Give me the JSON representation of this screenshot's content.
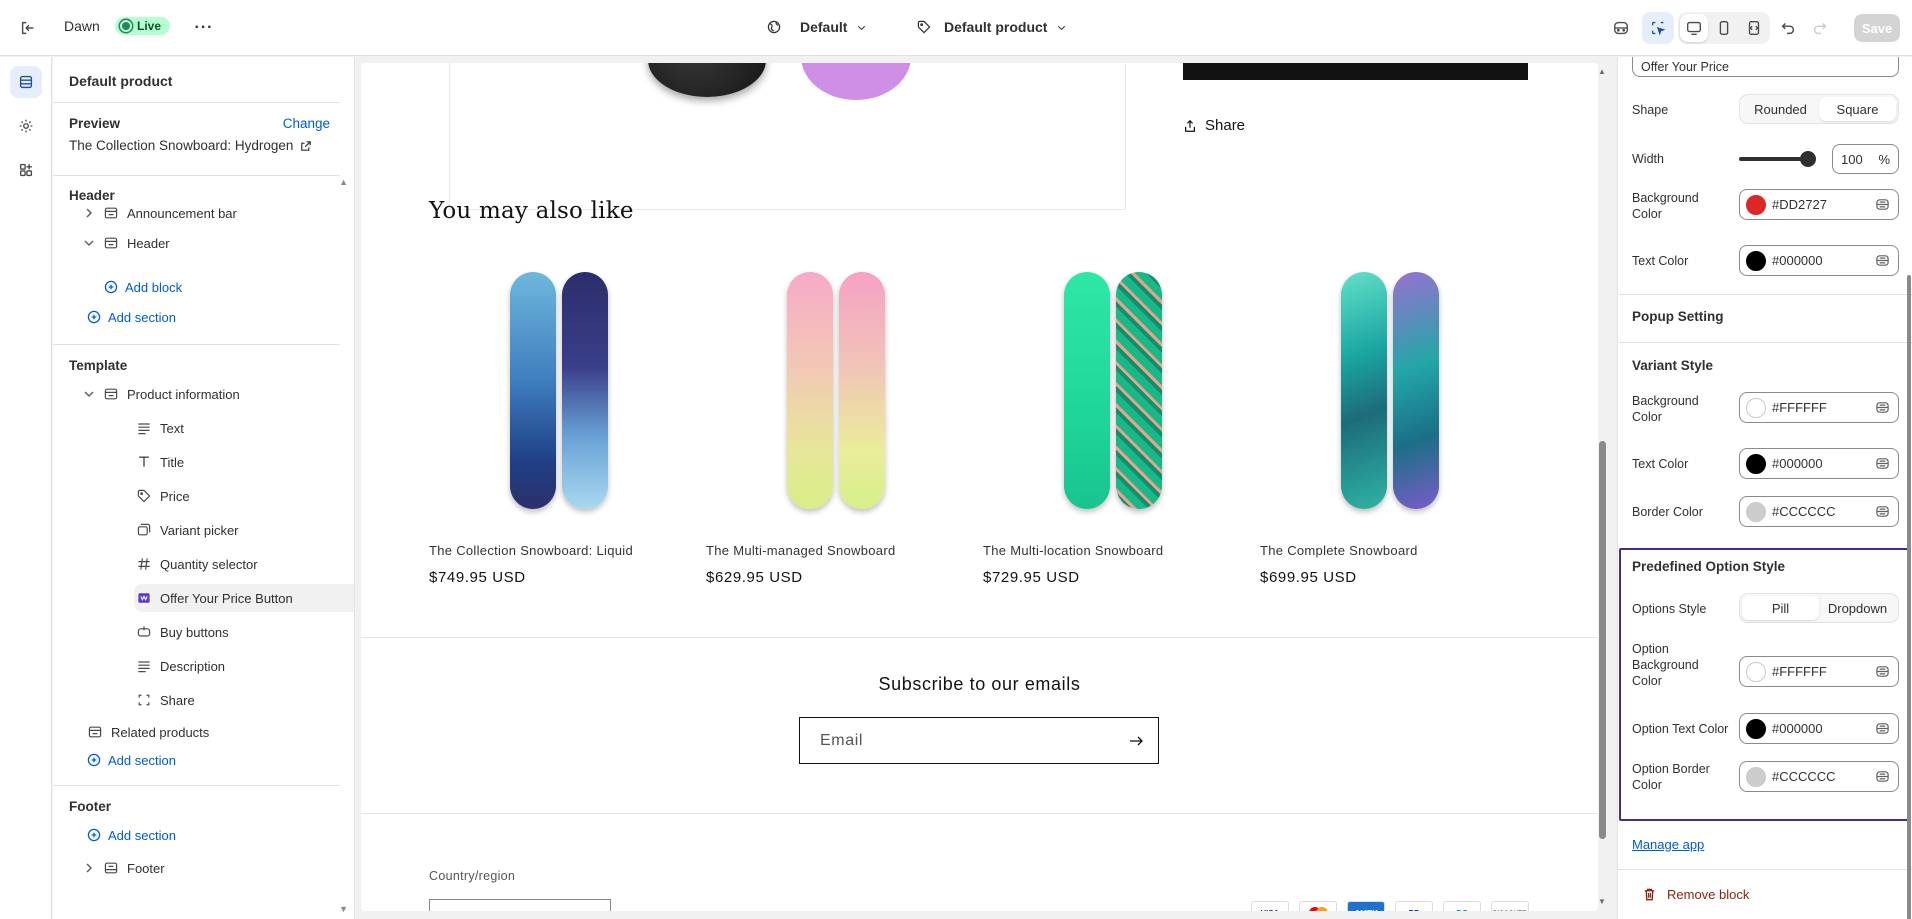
{
  "topbar": {
    "theme_name": "Dawn",
    "live_label": "Live",
    "more_label": "…",
    "context_select": "Default",
    "template_select": "Default product",
    "save_label": "Save"
  },
  "sidebar": {
    "title": "Default product",
    "preview_label": "Preview",
    "change_label": "Change",
    "preview_value": "The Collection Snowboard: Hydrogen",
    "header_group": "Header",
    "announcement_bar": "Announcement bar",
    "header_section": "Header",
    "add_block": "Add block",
    "add_section": "Add section",
    "template_group": "Template",
    "product_information": "Product information",
    "blocks": [
      {
        "label": "Text",
        "icon": "text-icon"
      },
      {
        "label": "Title",
        "icon": "title-icon"
      },
      {
        "label": "Price",
        "icon": "price-tag-icon"
      },
      {
        "label": "Variant picker",
        "icon": "variant-picker-icon"
      },
      {
        "label": "Quantity selector",
        "icon": "hash-icon"
      },
      {
        "label": "Offer Your Price Button",
        "icon": "app-block-icon"
      },
      {
        "label": "Buy buttons",
        "icon": "buy-button-icon"
      },
      {
        "label": "Description",
        "icon": "description-icon"
      },
      {
        "label": "Share",
        "icon": "share-frame-icon"
      }
    ],
    "related_products": "Related products",
    "footer_group": "Footer",
    "footer_section": "Footer"
  },
  "preview": {
    "share_label": "Share",
    "heading": "You may also like",
    "products": [
      {
        "name": "The Collection Snowboard: Liquid",
        "price": "$749.95 USD"
      },
      {
        "name": "The Multi-managed Snowboard",
        "price": "$629.95 USD"
      },
      {
        "name": "The Multi-location Snowboard",
        "price": "$729.95 USD"
      },
      {
        "name": "The Complete Snowboard",
        "price": "$699.95 USD"
      }
    ],
    "subscribe_heading": "Subscribe to our emails",
    "email_placeholder": "Email",
    "country_label": "Country/region",
    "payment_icons": [
      "VISA",
      "MC",
      "AMEX",
      "PP",
      "DC",
      "DISCOVER"
    ]
  },
  "settings": {
    "top_input_value": "Offer Your Price",
    "shape_label": "Shape",
    "shape_options": [
      "Rounded",
      "Square"
    ],
    "width_label": "Width",
    "width_value": "100",
    "width_unit": "%",
    "width_fraction": 1.0,
    "background_color_label": "Background Color",
    "background_color": "#DD2727",
    "text_color_label": "Text Color",
    "text_color": "#000000",
    "popup_setting": "Popup Setting",
    "variant_style": "Variant Style",
    "variant_bg_label": "Background Color",
    "variant_bg": "#FFFFFF",
    "variant_text_label": "Text Color",
    "variant_text": "#000000",
    "variant_border_label": "Border Color",
    "variant_border": "#CCCCCC",
    "predefined_option_style": "Predefined Option Style",
    "options_style_label": "Options Style",
    "options_style_options": [
      "Pill",
      "Dropdown"
    ],
    "option_bg_label": "Option Background Color",
    "option_bg": "#FFFFFF",
    "option_text_label": "Option Text Color",
    "option_text": "#000000",
    "option_border_label": "Option Border Color",
    "option_border": "#CCCCCC",
    "manage_app": "Manage app",
    "remove_block": "Remove block"
  }
}
